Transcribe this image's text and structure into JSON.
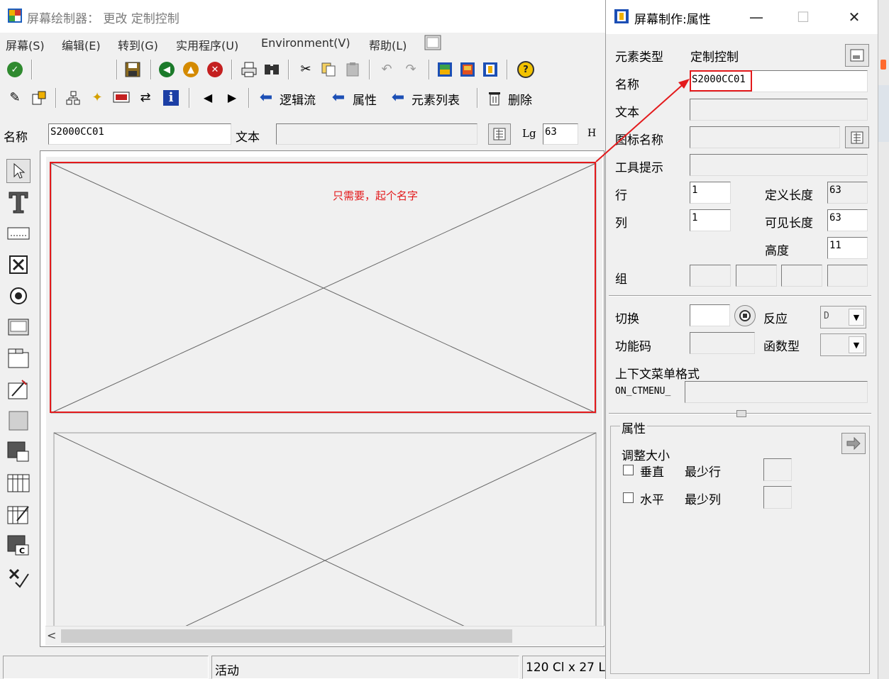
{
  "main_window": {
    "title": "屏幕绘制器： 更改 定制控制",
    "menu": [
      "屏幕(S)",
      "编辑(E)",
      "转到(G)",
      "实用程序(U)",
      "Environment(V)",
      "帮助(L)"
    ],
    "toolbar2_buttons": {
      "logic_flow": "逻辑流",
      "attributes": "属性",
      "element_list": "元素列表",
      "delete": "删除"
    },
    "name_row": {
      "name_label": "名称",
      "name_value": "S2000CC01",
      "text_label": "文本",
      "text_value": "",
      "lg_label": "Lg",
      "lg_value": "63",
      "h_label": "H"
    },
    "annotation": "只需要，起个名字",
    "status": {
      "mode": "活动",
      "size": "120 Cl x 27 L"
    }
  },
  "props_dialog": {
    "title": "屏幕制作:属性",
    "element_type_label": "元素类型",
    "element_type_value": "定制控制",
    "name_label": "名称",
    "name_value": "S2000CC01",
    "text_label": "文本",
    "icon_name_label": "图标名称",
    "tooltip_label": "工具提示",
    "row_label": "行",
    "row_value": "1",
    "col_label": "列",
    "col_value": "1",
    "def_length_label": "定义长度",
    "def_length_value": "63",
    "vis_length_label": "可见长度",
    "vis_length_value": "63",
    "height_label": "高度",
    "height_value": "11",
    "group_label": "组",
    "switch_label": "切换",
    "reaction_label": "反应",
    "reaction_value": "D",
    "fcode_label": "功能码",
    "ftype_label": "函数型",
    "ctx_menu_label": "上下文菜单格式",
    "ctx_menu_prefix": "ON_CTMENU_",
    "attr_section_label": "属性",
    "resize_label": "调整大小",
    "vertical_label": "垂直",
    "min_rows_label": "最少行",
    "horizontal_label": "水平",
    "min_cols_label": "最少列"
  },
  "colors": {
    "annotation": "#e31a1c",
    "window_bg": "#f0f0f0"
  }
}
